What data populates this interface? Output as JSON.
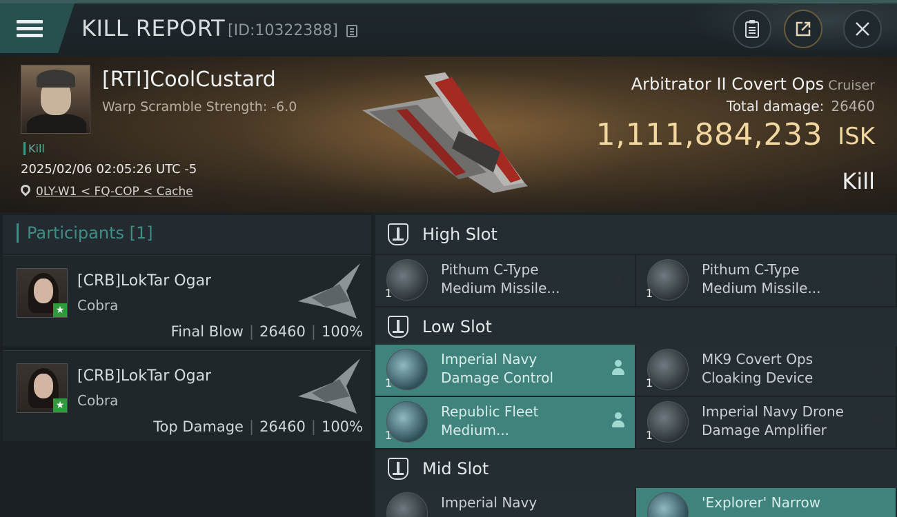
{
  "header": {
    "title": "KILL REPORT",
    "report_id": "[ID:10322388]"
  },
  "victim": {
    "name": "[RTI]CoolCustard",
    "warp_scramble": "Warp Scramble Strength: -6.0",
    "tag": "Kill",
    "datetime": "2025/02/06 02:05:26 UTC -5",
    "location": "0LY-W1 < FQ-COP < Cache",
    "ship_name": "Arbitrator II Covert Ops",
    "ship_class": "Cruiser",
    "total_damage_label": "Total damage:",
    "total_damage": "26460",
    "isk_value": "1,111,884,233",
    "isk_unit": "ISK",
    "result": "Kill"
  },
  "participants": {
    "title": "Participants [1]",
    "rows": [
      {
        "name": "[CRB]LokTar Ogar",
        "ship": "Cobra",
        "role": "Final Blow",
        "damage": "26460",
        "percent": "100%"
      },
      {
        "name": "[CRB]LokTar Ogar",
        "ship": "Cobra",
        "role": "Top Damage",
        "damage": "26460",
        "percent": "100%"
      }
    ]
  },
  "fitting": {
    "high_slot": {
      "title": "High Slot",
      "modules": [
        {
          "line1": "Pithum C-Type",
          "line2": "Medium Missile...",
          "qty": "1"
        },
        {
          "line1": "Pithum C-Type",
          "line2": "Medium Missile...",
          "qty": "1"
        }
      ]
    },
    "low_slot": {
      "title": "Low Slot",
      "modules": [
        {
          "line1": "Imperial Navy",
          "line2": "Damage Control",
          "qty": "1"
        },
        {
          "line1": "MK9 Covert Ops",
          "line2": "Cloaking Device",
          "qty": "1"
        },
        {
          "line1": "Republic Fleet",
          "line2": "Medium...",
          "qty": "1"
        },
        {
          "line1": "Imperial Navy Drone",
          "line2": "Damage Amplifier",
          "qty": "1"
        }
      ]
    },
    "mid_slot": {
      "title": "Mid Slot",
      "modules": [
        {
          "line1": "Imperial Navy",
          "line2": "",
          "qty": ""
        },
        {
          "line1": "'Explorer' Narrow",
          "line2": "",
          "qty": ""
        }
      ]
    }
  },
  "colors": {
    "accent_teal": "#3f837c",
    "isk_gold": "#f2d8a0",
    "final_star": "#2f9a3c"
  }
}
